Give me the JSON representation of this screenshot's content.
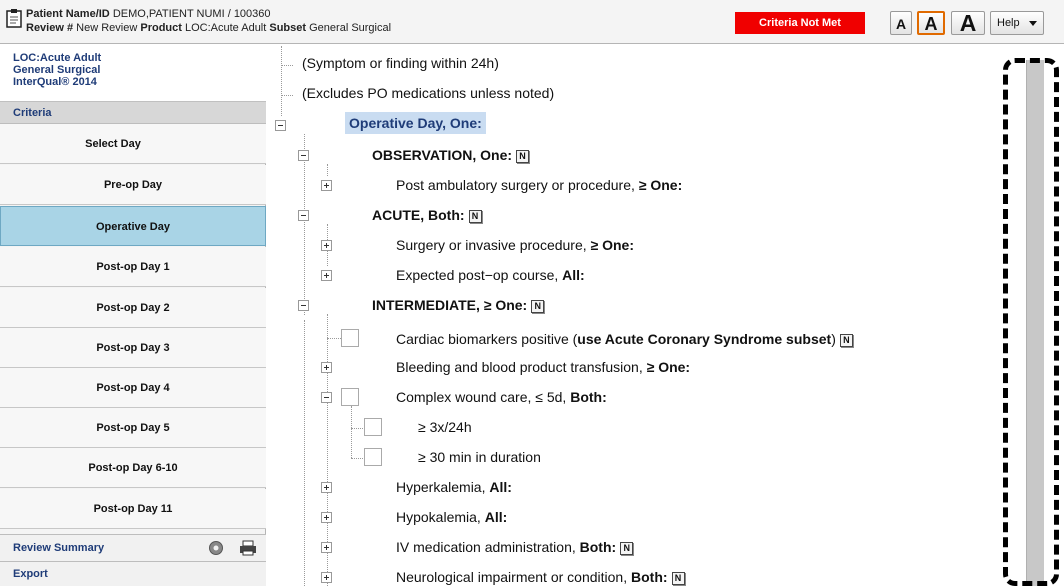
{
  "header": {
    "patient_label": "Patient Name/ID",
    "patient_value": "DEMO,PATIENT NUMI / 100360",
    "review_label": "Review #",
    "review_value": "New Review",
    "product_label": "Product",
    "product_value": "LOC:Acute Adult",
    "subset_label": "Subset",
    "subset_value": "General Surgical",
    "status": "Criteria Not Met",
    "font_small": "A",
    "font_medium": "A",
    "font_large": "A",
    "help": "Help"
  },
  "sidebar": {
    "loc_lines": [
      "LOC:Acute Adult",
      "General Surgical",
      "InterQual® 2014"
    ],
    "criteria_header": "Criteria",
    "select_day": "Select Day",
    "days": [
      "Pre-op Day",
      "Operative Day",
      "Post-op Day 1",
      "Post-op Day 2",
      "Post-op Day 3",
      "Post-op Day 4",
      "Post-op Day 5",
      "Post-op Day 6-10",
      "Post-op Day 11"
    ],
    "selected_day": "Operative Day",
    "review_summary": "Review Summary",
    "export": "Export"
  },
  "tree": {
    "note1": "(Symptom or finding within 24h)",
    "note2": "(Excludes PO medications unless noted)",
    "operative": "Operative Day, One:",
    "observation": "OBSERVATION, One:",
    "post_amb_a": "Post ambulatory surgery or procedure, ",
    "post_amb_b": "≥ One:",
    "acute": "ACUTE, Both:",
    "surgery_a": "Surgery or invasive procedure, ",
    "surgery_b": "≥ One:",
    "expected_a": "Expected post−op course, ",
    "expected_b": "All:",
    "intermediate": "INTERMEDIATE, ≥ One:",
    "cardiac_a": "Cardiac biomarkers positive (",
    "cardiac_b": "use Acute Coronary Syndrome subset",
    "cardiac_c": ")",
    "bleeding_a": "Bleeding and blood product transfusion, ",
    "bleeding_b": "≥ One:",
    "wound_a": "Complex wound care, ≤ 5d, ",
    "wound_b": "Both:",
    "wound_sub1": "≥ 3x/24h",
    "wound_sub2": "≥ 30 min in duration",
    "hyperk_a": "Hyperkalemia, ",
    "hyperk_b": "All:",
    "hypok_a": "Hypokalemia, ",
    "hypok_b": "All:",
    "iv_a": "IV medication administration, ",
    "iv_b": "Both:",
    "neuro_a": "Neurological impairment or condition, ",
    "neuro_b": "Both:",
    "note_badge": "N"
  },
  "colors": {
    "status_red": "#f00000",
    "selected_day": "#a9d4e6",
    "highlight": "#c9dcf1",
    "label_blue": "#1f3c78"
  }
}
